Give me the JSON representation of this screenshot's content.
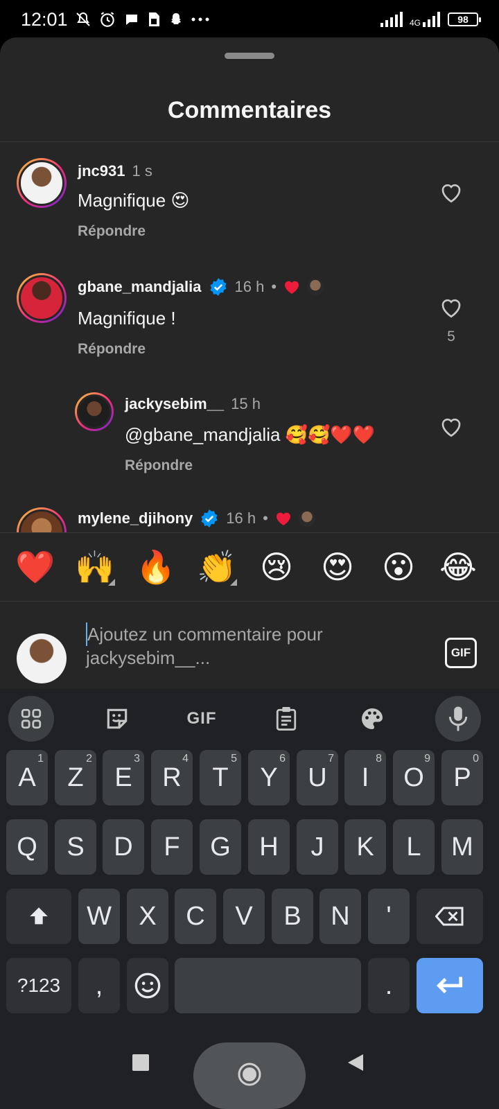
{
  "status_bar": {
    "time": "12:01",
    "network": "4G",
    "battery": "98",
    "left_icons": [
      "bell-off-icon",
      "alarm-icon",
      "chat-bubble-icon",
      "sim-icon",
      "snapchat-icon",
      "more-icon"
    ],
    "right_icons": [
      "signal-icon",
      "signal-4g-icon",
      "battery-icon"
    ]
  },
  "sheet": {
    "title": "Commentaires"
  },
  "comments": [
    {
      "username": "jnc931",
      "time": "1 s",
      "text": "Magnifique 😍",
      "reply_label": "Répondre",
      "verified": false,
      "likes": ""
    },
    {
      "username": "gbane_mandjalia",
      "time": "16 h",
      "separator": "•",
      "text": "Magnifique !",
      "reply_label": "Répondre",
      "verified": true,
      "likes": "5"
    },
    {
      "username": "jackysebim__",
      "time": "15 h",
      "text": "@gbane_mandjalia 🥰🥰❤️❤️",
      "reply_label": "Répondre",
      "verified": false,
      "likes": "",
      "is_reply": true
    },
    {
      "username": "mylene_djihony",
      "time": "16 h",
      "separator": "•",
      "verified": true
    }
  ],
  "emoji_bar": [
    "❤️",
    "🙌",
    "🔥",
    "👏",
    "😢",
    "😍",
    "😮",
    "😂"
  ],
  "input": {
    "placeholder": "Ajoutez un commentaire pour jackysebim__...",
    "gif_label": "GIF"
  },
  "keyboard": {
    "toolbar": [
      "apps-icon",
      "sticker-icon",
      "GIF",
      "clipboard-icon",
      "palette-icon",
      "mic-icon"
    ],
    "gif_label": "GIF",
    "row1": [
      {
        "k": "A",
        "h": "1"
      },
      {
        "k": "Z",
        "h": "2"
      },
      {
        "k": "E",
        "h": "3"
      },
      {
        "k": "R",
        "h": "4"
      },
      {
        "k": "T",
        "h": "5"
      },
      {
        "k": "Y",
        "h": "6"
      },
      {
        "k": "U",
        "h": "7"
      },
      {
        "k": "I",
        "h": "8"
      },
      {
        "k": "O",
        "h": "9"
      },
      {
        "k": "P",
        "h": "0"
      }
    ],
    "row2": [
      "Q",
      "S",
      "D",
      "F",
      "G",
      "H",
      "J",
      "K",
      "L",
      "M"
    ],
    "row3": [
      "W",
      "X",
      "C",
      "V",
      "B",
      "N",
      "'"
    ],
    "row4": {
      "sym": "?123",
      "comma": ",",
      "period": "."
    }
  },
  "colors": {
    "sheet_bg": "#262626",
    "keyboard_bg": "#202124",
    "key_bg": "#3c4043",
    "enter_key": "#5e9cf2",
    "verified_blue": "#0095f6",
    "heart_red": "#ed1c3a"
  }
}
